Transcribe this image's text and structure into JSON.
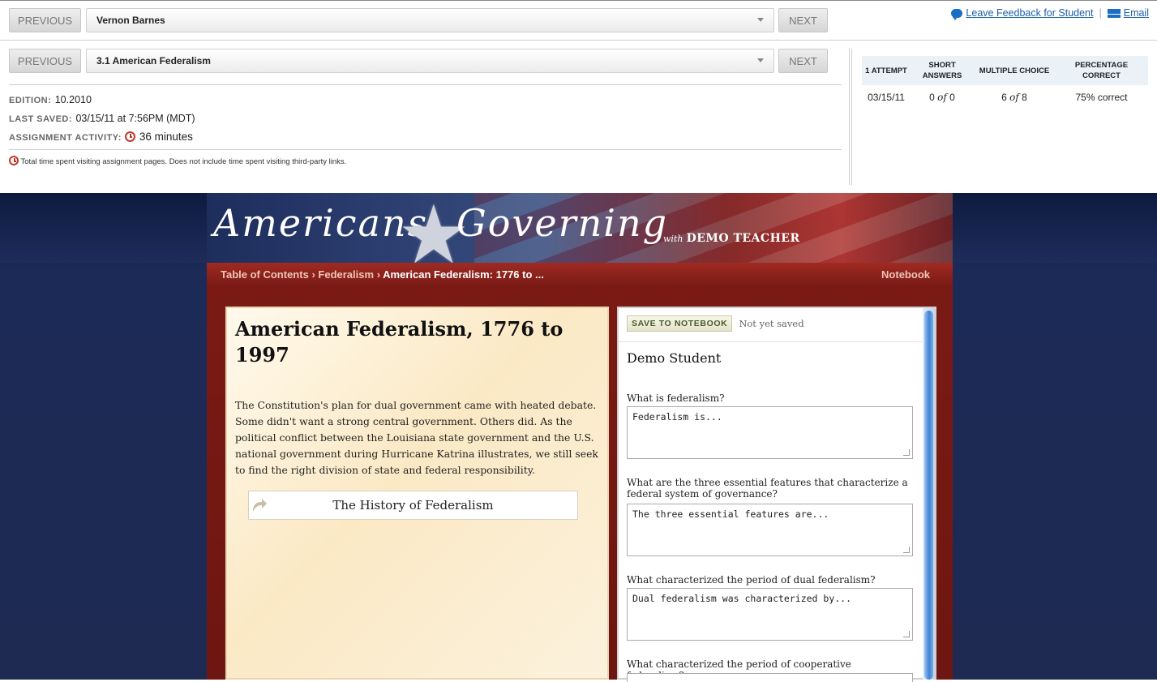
{
  "student_nav": {
    "previous_label": "PREVIOUS",
    "selected": "Vernon Barnes",
    "next_label": "NEXT"
  },
  "assignment_nav": {
    "previous_label": "PREVIOUS",
    "selected": "3.1 American Federalism",
    "next_label": "NEXT"
  },
  "links": {
    "feedback": "Leave Feedback for Student",
    "email": "Email",
    "separator": "|"
  },
  "meta": {
    "edition_label": "EDITION:",
    "edition_value": "10.2010",
    "saved_label": "LAST SAVED:",
    "saved_value": "03/15/11 at 7:56PM (MDT)",
    "activity_label": "ASSIGNMENT ACTIVITY:",
    "activity_value": "36 minutes",
    "note": "Total time spent visiting assignment pages. Does not include time spent visiting third-party links."
  },
  "stats": {
    "headers": [
      "1 ATTEMPT",
      "SHORT ANSWERS",
      "MULTIPLE CHOICE",
      "PERCENTAGE CORRECT"
    ],
    "row": {
      "date": "03/15/11",
      "short_answers_a": "0",
      "short_answers_of": "of",
      "short_answers_b": "0",
      "mc_a": "6",
      "mc_of": "of",
      "mc_b": "8",
      "percentage": "75% correct"
    }
  },
  "banner": {
    "brand_left": "Americans",
    "brand_right": "Governing",
    "with": "with",
    "teacher": "DEMO TEACHER"
  },
  "breadcrumb": {
    "toc": "Table of Contents",
    "sep1": "›",
    "section": "Federalism",
    "sep2": "›",
    "current": "American Federalism: 1776 to ...",
    "notebook": "Notebook"
  },
  "lesson": {
    "title": "American Federalism, 1776 to 1997",
    "body": "The Constitution's plan for dual government came with heated debate. Some didn't want a strong central government. Others did. As the political conflict between the Louisiana state government and the U.S. national government during Hurricane Katrina illustrates, we still seek to find the right division of state and federal responsibility.",
    "link": "The History of Federalism"
  },
  "notebook": {
    "save_label": "SAVE TO NOTEBOOK",
    "save_status": "Not yet saved",
    "student_name": "Demo Student",
    "questions": [
      {
        "label": "What is federalism?",
        "value": "Federalism is..."
      },
      {
        "label": "What are the three essential features that characterize a federal system of governance?",
        "value": "The three essential features are..."
      },
      {
        "label": "What characterized the period of dual federalism?",
        "value": "Dual federalism was characterized by..."
      },
      {
        "label": "What characterized the period of cooperative federalism?",
        "value": ""
      }
    ]
  },
  "colors": {
    "accent_red": "#c0392b",
    "link_blue": "#1a5fa8",
    "nav_red": "#8b2018",
    "page_navy": "#1b2a56"
  }
}
